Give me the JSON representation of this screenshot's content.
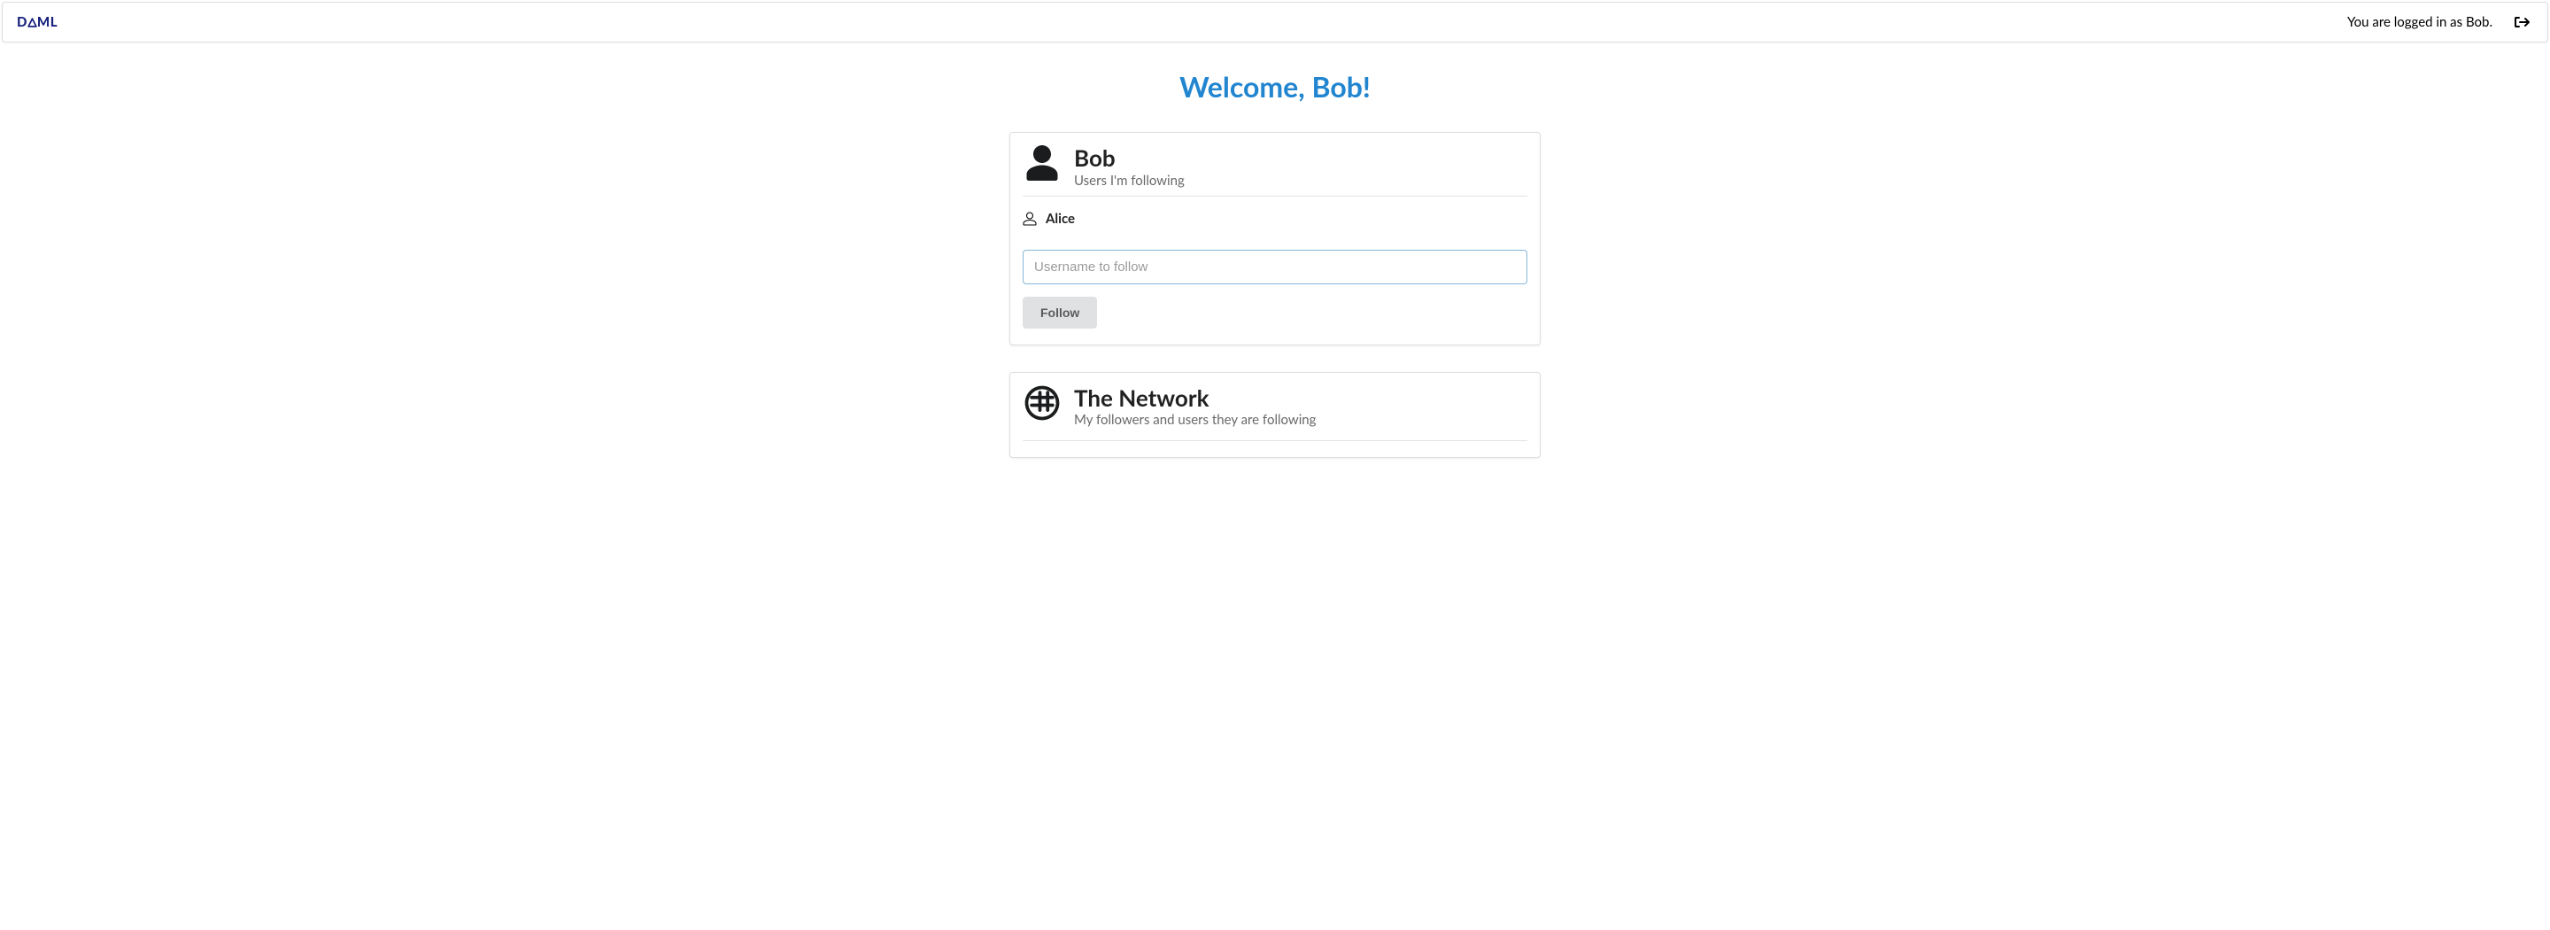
{
  "header": {
    "brand": "DAML",
    "login_status": "You are logged in as Bob."
  },
  "main": {
    "welcome": "Welcome, Bob!",
    "profile": {
      "name": "Bob",
      "subtitle": "Users I'm following",
      "following": [
        "Alice"
      ],
      "follow_input_placeholder": "Username to follow",
      "follow_button_label": "Follow"
    },
    "network": {
      "title": "The Network",
      "subtitle": "My followers and users they are following"
    }
  }
}
